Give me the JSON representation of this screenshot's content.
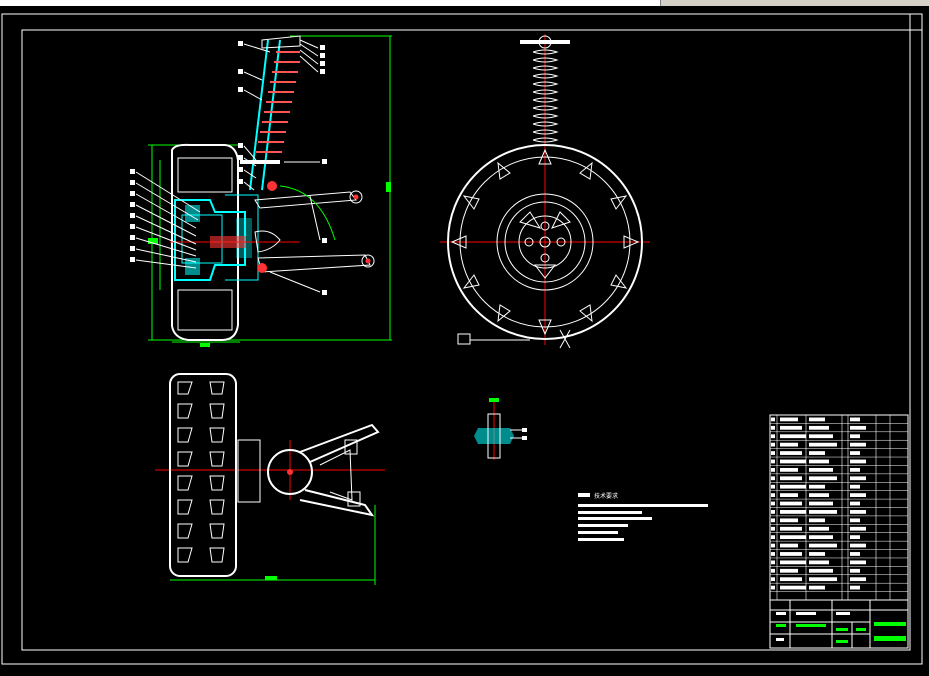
{
  "window": {
    "segments": 3
  },
  "drawing": {
    "background": "#000000",
    "colors": {
      "frame": "#ffffff",
      "dimension": "#00ff00",
      "centerline": "#ff0000",
      "part": "#ffffff",
      "section": "#00ffff",
      "highlight": "#ff3333"
    },
    "notes_heading": "技术要求",
    "notes_lines": 6,
    "title_block": {
      "rows": 22,
      "columns": 6
    }
  }
}
